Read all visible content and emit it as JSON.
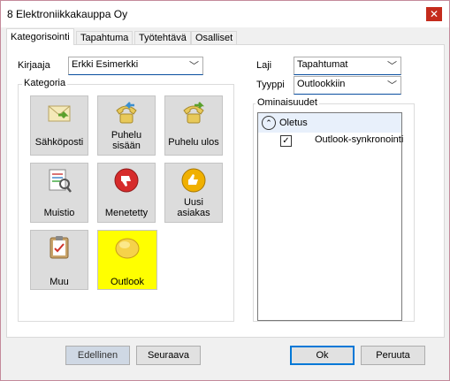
{
  "window": {
    "title": "8 Elektroniikkakauppa Oy",
    "close_glyph": "✕"
  },
  "tabs": [
    {
      "label": "Kategorisointi",
      "active": true
    },
    {
      "label": "Tapahtuma",
      "active": false
    },
    {
      "label": "Työtehtävä",
      "active": false
    },
    {
      "label": "Osalliset",
      "active": false
    }
  ],
  "form": {
    "kirjaaja_label": "Kirjaaja",
    "kirjaaja_value": "Erkki Esimerkki",
    "laji_label": "Laji",
    "laji_value": "Tapahtumat",
    "tyyppi_label": "Tyyppi",
    "tyyppi_value": "Outlookkiin"
  },
  "kategoria": {
    "title": "Kategoria",
    "tiles": [
      {
        "label": "Sähköposti",
        "icon": "email-icon"
      },
      {
        "label": "Puhelu sisään",
        "label1": "Puhelu",
        "label2": "sisään",
        "icon": "phone-in-icon"
      },
      {
        "label": "Puhelu ulos",
        "icon": "phone-out-icon"
      },
      {
        "label": "Muistio",
        "icon": "memo-icon"
      },
      {
        "label": "Menetetty",
        "icon": "thumbs-down-icon"
      },
      {
        "label": "Uusi asiakas",
        "label1": "Uusi",
        "label2": "asiakas",
        "icon": "thumbs-up-icon"
      },
      {
        "label": "Muu",
        "icon": "clipboard-icon"
      },
      {
        "label": "Outlook",
        "icon": "outlook-icon",
        "selected": true
      }
    ]
  },
  "ominaisuudet": {
    "title": "Ominaisuudet",
    "group_label": "Oletus",
    "item_label": "Outlook-synkronointi",
    "item_checked": true
  },
  "buttons": {
    "previous": "Edellinen",
    "next": "Seuraava",
    "ok": "Ok",
    "cancel": "Peruuta"
  },
  "colors": {
    "selected_tile": "#ffff00",
    "close": "#c42b1c",
    "accent": "#0078d7"
  }
}
